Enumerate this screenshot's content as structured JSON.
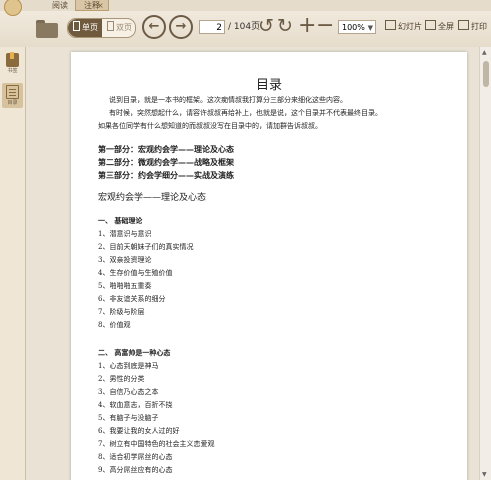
{
  "tabs": {
    "read": "阅读",
    "notes": "注释",
    "close": "×"
  },
  "toolbar": {
    "view_single": "单页",
    "view_double": "双页",
    "prev": "←",
    "next": "→",
    "page_current": "2",
    "page_total": "/ 104页",
    "rotate_left": "↺",
    "rotate_right": "↻",
    "zoom_in": "+",
    "zoom_out": "−",
    "zoom": "100%",
    "slideshow": "幻灯片",
    "fullscreen": "全屏",
    "print": "打印"
  },
  "sidebar": {
    "bookshelf": "书签",
    "toc": "目录"
  },
  "doc": {
    "title": "目录",
    "intro": [
      "说到目录，就是一本书的框架。这次痴情叔我打算分三部分来细化这些内容。",
      "有时候，突然想起什么，请容许叔叔再给补上，也就是说，这个目录并不代表最终目录。",
      "如果各位同学有什么想知道的而叔叔没写在目录中的，请加群告诉叔叔。"
    ],
    "parts": [
      "第一部分：宏观约会学——理论及心态",
      "第二部分：微观约会学——战略及框架",
      "第三部分：约会学细分——实战及演练"
    ],
    "section_title": "宏观约会学——理论及心态",
    "sub1": "一、 基础理论",
    "list1": [
      "1、潜意识与意识",
      "2、目前天朝妹子们的真实情况",
      "3、双亲投资理论",
      "4、生存价值与生殖价值",
      "5、啪啪啪五重奏",
      "6、非友谊关系的细分",
      "7、阶级与阶层",
      "8、价值观"
    ],
    "sub2": "二、 高富帅是一种心态",
    "list2": [
      "1、心态到底是神马",
      "2、男性的分类",
      "3、自信乃心态之本",
      "4、软血意志，百折不挠",
      "5、有脑子与没脑子",
      "6、我要让我的女人过的好",
      "7、树立有中国特色的社会主义恋爱观",
      "8、适合初学屌丝的心态",
      "9、高分屌丝应有的心态"
    ]
  }
}
